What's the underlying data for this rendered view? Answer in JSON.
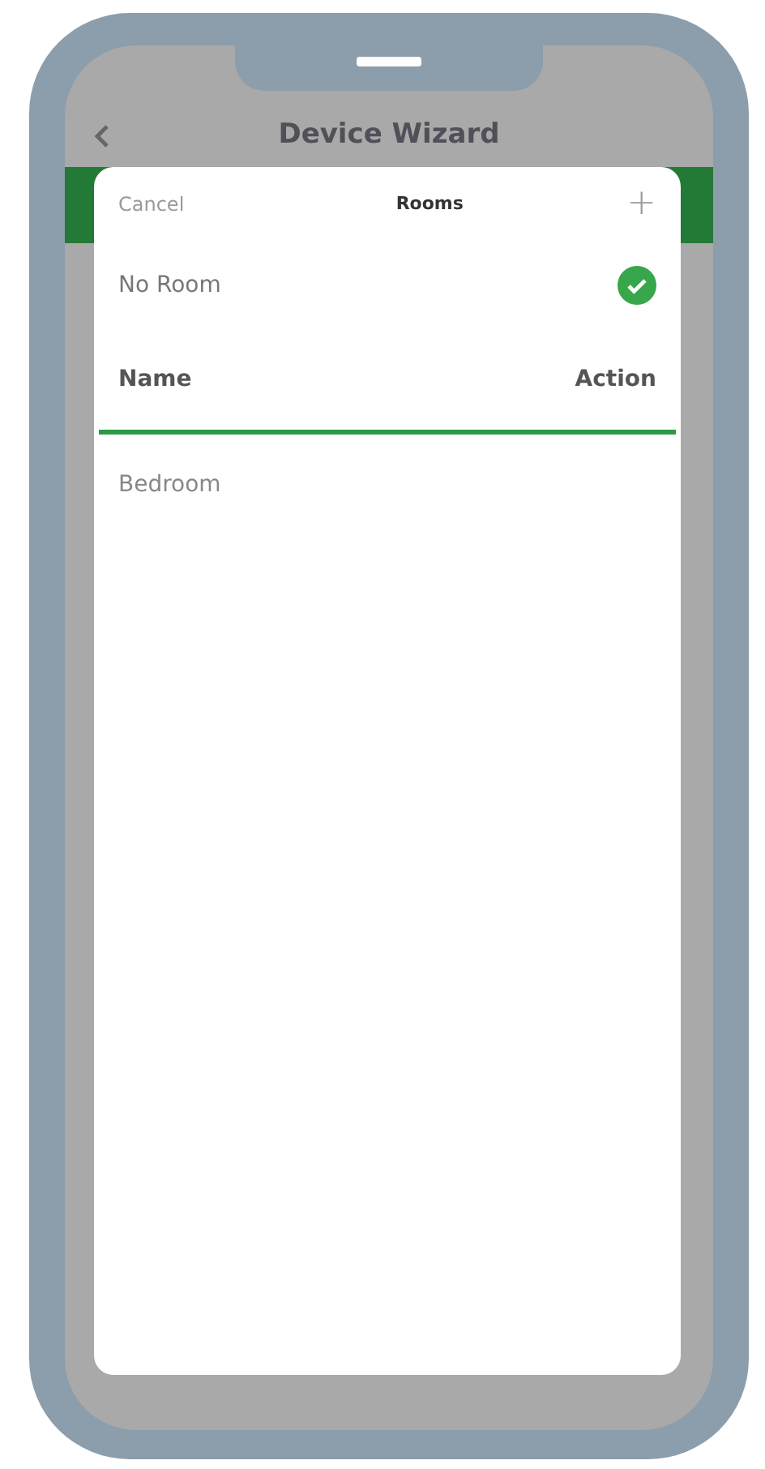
{
  "header": {
    "title": "Device Wizard"
  },
  "sheet": {
    "cancel": "Cancel",
    "title": "Rooms",
    "add": "+"
  },
  "options": [
    {
      "label": "No Room",
      "selected": true
    }
  ],
  "table": {
    "columns": [
      "Name",
      "Action"
    ],
    "rows": [
      {
        "name": "Bedroom",
        "selected": false
      }
    ]
  }
}
